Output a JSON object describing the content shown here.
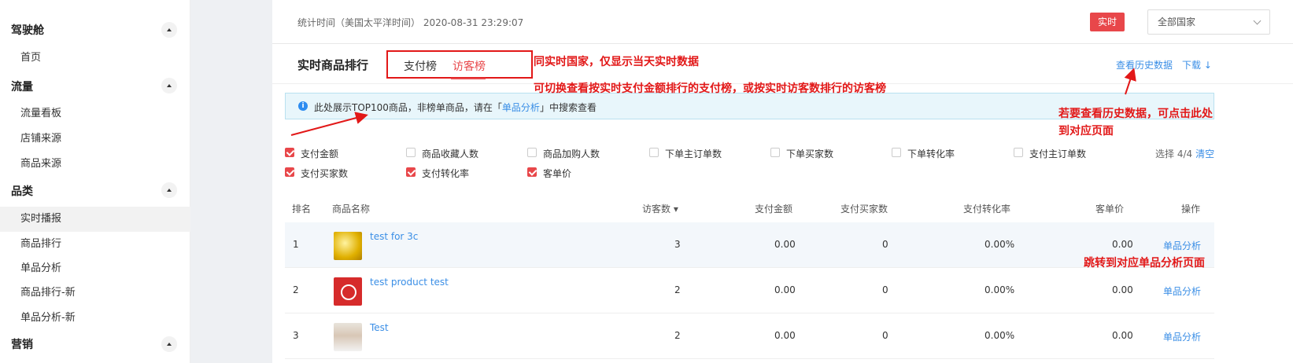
{
  "sidebar": {
    "sections": [
      {
        "title": "驾驶舱",
        "items": [
          "首页"
        ]
      },
      {
        "title": "流量",
        "items": [
          "流量看板",
          "店铺来源",
          "商品来源"
        ]
      },
      {
        "title": "品类",
        "items": [
          "实时播报",
          "商品排行",
          "单品分析",
          "商品排行-新",
          "单品分析-新"
        ]
      },
      {
        "title": "营销",
        "items": []
      }
    ],
    "active_item": "实时播报"
  },
  "topbar": {
    "stat_time": "统计时间（美国太平洋时间） 2020-08-31 23:29:07",
    "realtime_label": "实时",
    "country_select": "全部国家"
  },
  "section": {
    "title": "实时商品排行",
    "tabs": [
      "支付榜",
      "访客榜"
    ],
    "active_tab": "访客榜",
    "history_link": "查看历史数据",
    "download_link": "下载 ↓"
  },
  "notice": {
    "prefix": "此处展示TOP100商品，非榜单商品，请在「",
    "link": "单品分析",
    "suffix": "」中搜索查看"
  },
  "metrics": [
    {
      "label": "支付金额",
      "checked": true
    },
    {
      "label": "商品收藏人数",
      "checked": false
    },
    {
      "label": "商品加购人数",
      "checked": false
    },
    {
      "label": "下单主订单数",
      "checked": false
    },
    {
      "label": "下单买家数",
      "checked": false
    },
    {
      "label": "下单转化率",
      "checked": false
    },
    {
      "label": "支付主订单数",
      "checked": false
    },
    {
      "label": "支付买家数",
      "checked": true
    },
    {
      "label": "支付转化率",
      "checked": true
    },
    {
      "label": "客单价",
      "checked": true
    }
  ],
  "selection": {
    "count": "选择 4/4",
    "clear": "清空"
  },
  "table": {
    "headers": [
      "排名",
      "商品名称",
      "访客数 ▾",
      "支付金额",
      "支付买家数",
      "支付转化率",
      "客单价",
      "操作"
    ],
    "rows": [
      {
        "rank": "1",
        "name": "test for 3c",
        "visitors": "3",
        "amount": "0.00",
        "buyers": "0",
        "rate": "0.00%",
        "avg": "0.00",
        "op": "单品分析"
      },
      {
        "rank": "2",
        "name": "test product test",
        "visitors": "2",
        "amount": "0.00",
        "buyers": "0",
        "rate": "0.00%",
        "avg": "0.00",
        "op": "单品分析"
      },
      {
        "rank": "3",
        "name": "Test",
        "visitors": "2",
        "amount": "0.00",
        "buyers": "0",
        "rate": "0.00%",
        "avg": "0.00",
        "op": "单品分析"
      }
    ]
  },
  "annotations": {
    "a1": "同实时国家，仅显示当天实时数据",
    "a2": "可切换查看按实时支付金额排行的支付榜，或按实时访客数排行的访客榜",
    "a3_line1": "若要查看历史数据，可点击此处",
    "a3_line2": "到对应页面",
    "a4": "跳转到对应单品分析页面",
    "color": "#e21818"
  }
}
